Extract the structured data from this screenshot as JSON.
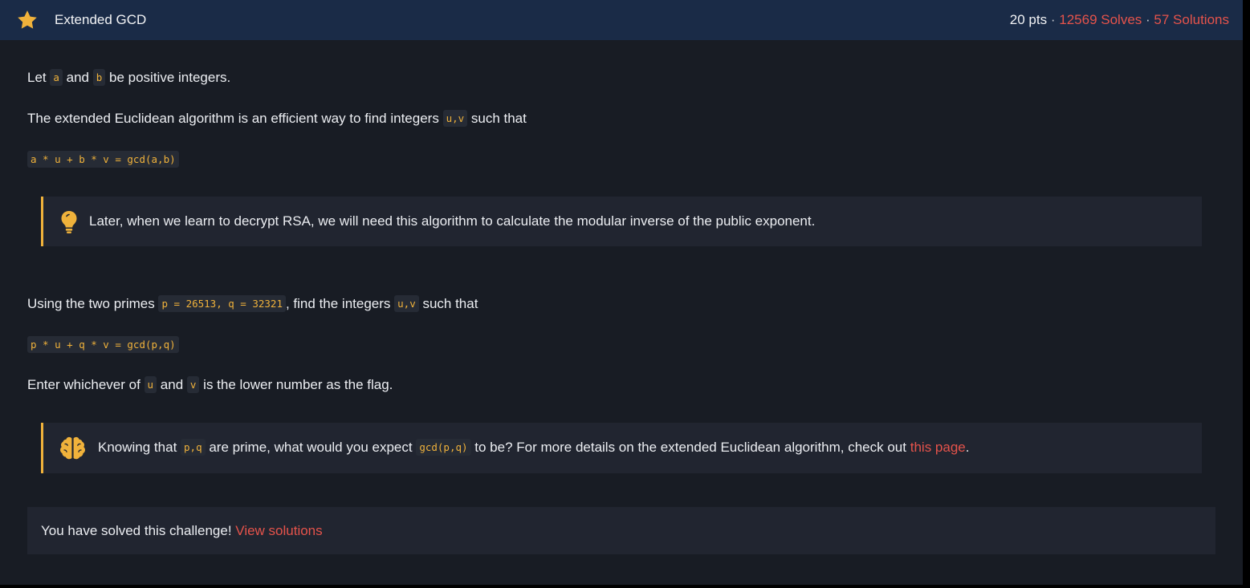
{
  "header": {
    "title": "Extended GCD",
    "points": "20 pts",
    "separator": "·",
    "solves": "12569 Solves",
    "solutions": "57 Solutions"
  },
  "intro": {
    "let": "Let",
    "a": "a",
    "and": "and",
    "b": "b",
    "be_positive": "be positive integers."
  },
  "euclid": {
    "text": "The extended Euclidean algorithm is an efficient way to find integers",
    "uv": "u,v",
    "such_that": "such that"
  },
  "formula1": "a * u + b * v = gcd(a,b)",
  "hint1": {
    "icon": "lightbulb-icon",
    "text": "Later, when we learn to decrypt RSA, we will need this algorithm to calculate the modular inverse of the public exponent."
  },
  "primes": {
    "text": "Using the two primes",
    "values": "p = 26513, q = 32321",
    "find": ", find the integers",
    "uv": "u,v",
    "such_that": "such that"
  },
  "formula2": "p * u + q * v = gcd(p,q)",
  "flag": {
    "text": "Enter whichever of",
    "u": "u",
    "and": "and",
    "v": "v",
    "rest": "is the lower number as the flag."
  },
  "hint2": {
    "icon": "brain-icon",
    "knowing": "Knowing that",
    "pq": "p,q",
    "are_prime": "are prime, what would you expect",
    "gcd": "gcd(p,q)",
    "to_be": "to be? For more details on the extended Euclidean algorithm, check out",
    "link": "this page",
    "period": "."
  },
  "solved": {
    "text": "You have solved this challenge!",
    "link": "View solutions"
  },
  "colors": {
    "accent": "#f0b23b",
    "link": "#e5534b",
    "header_bg": "#1a2b47",
    "panel_bg": "#181c24"
  }
}
